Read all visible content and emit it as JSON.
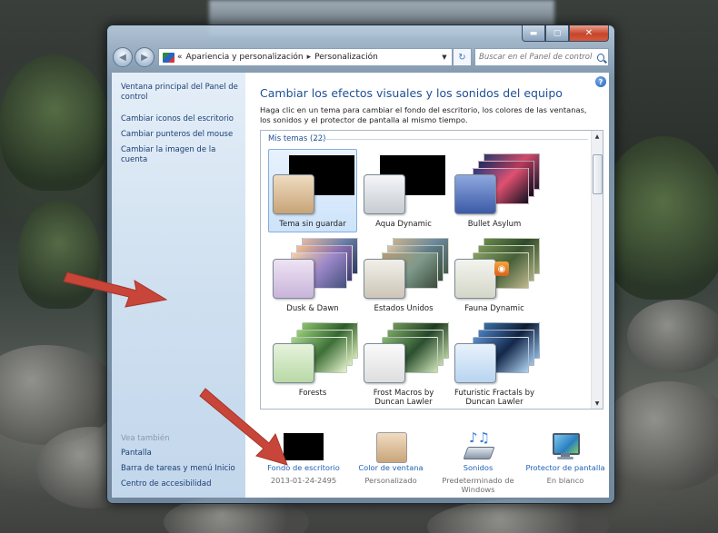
{
  "window": {
    "breadcrumb": [
      "Apariencia y personalización",
      "Personalización"
    ],
    "search_placeholder": "Buscar en el Panel de control"
  },
  "sidebar": {
    "home_link": "Ventana principal del Panel de control",
    "links": [
      "Cambiar iconos del escritorio",
      "Cambiar punteros del mouse",
      "Cambiar la imagen de la cuenta"
    ],
    "see_also_title": "Vea también",
    "see_also": [
      "Pantalla",
      "Barra de tareas y menú Inicio",
      "Centro de accesibilidad"
    ]
  },
  "main": {
    "title": "Cambiar los efectos visuales y los sonidos del equipo",
    "description": "Haga clic en un tema para cambiar el fondo del escritorio, los colores de las ventanas, los sonidos y el protector de pantalla al mismo tiempo.",
    "group_header": "Mis temas (22)",
    "themes": [
      "Tema sin guardar",
      "Aqua Dynamic",
      "Bullet Asylum",
      "Dusk & Dawn",
      "Estados Unidos",
      "Fauna Dynamic",
      "Forests",
      "Frost Macros by Duncan Lawler",
      "Futuristic Fractals by Duncan Lawler"
    ],
    "selected_theme": "Tema sin guardar"
  },
  "bottom": {
    "items": [
      {
        "link": "Fondo de escritorio",
        "value": "2013-01-24-2495"
      },
      {
        "link": "Color de ventana",
        "value": "Personalizado"
      },
      {
        "link": "Sonidos",
        "value": "Predeterminado de Windows"
      },
      {
        "link": "Protector de pantalla",
        "value": "En blanco"
      }
    ]
  },
  "colors": {
    "link": "#1d62b5",
    "title": "#1e4f96",
    "annotation_arrow": "#c8453a"
  }
}
